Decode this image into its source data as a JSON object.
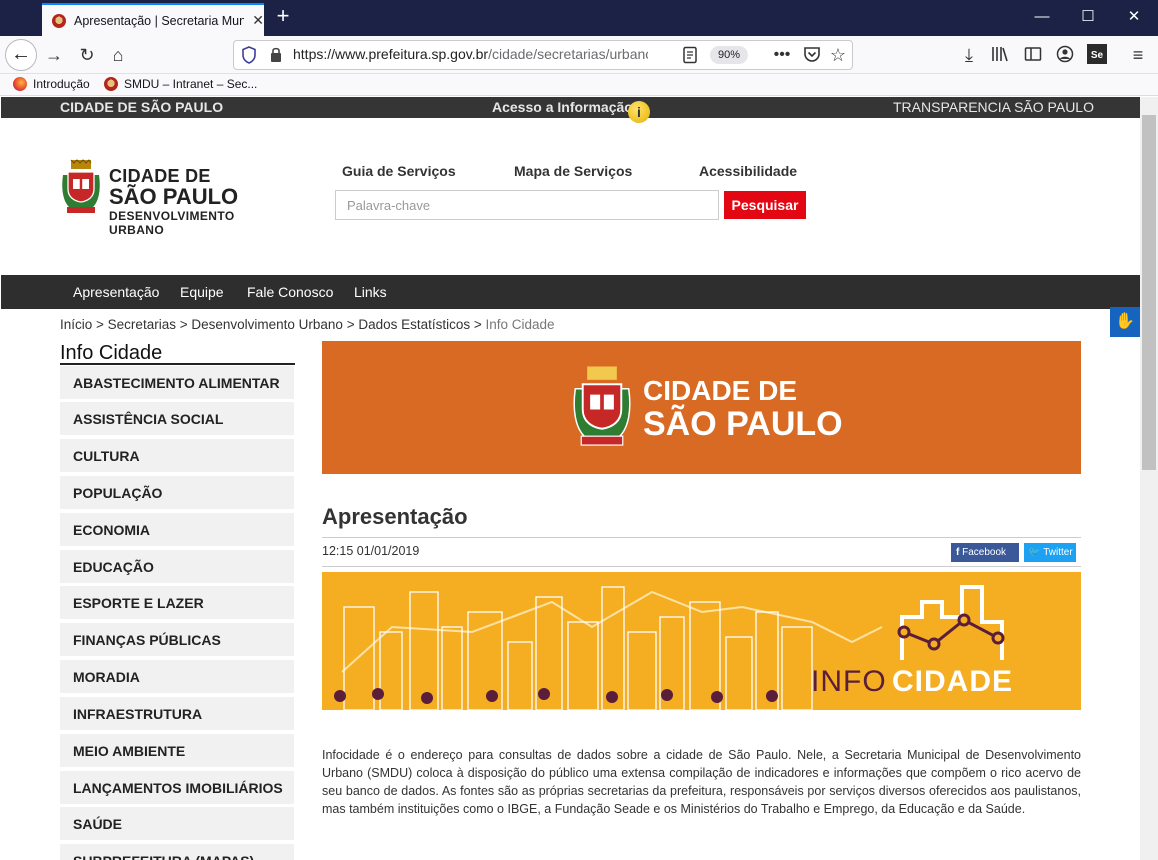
{
  "browser": {
    "tab_title": "Apresentação | Secretaria Muni",
    "url_host": "https://www.prefeitura.sp.gov.br",
    "url_path": "/cidade/secretarias/urbano",
    "zoom": "90%",
    "bookmarks": [
      "Introdução",
      "SMDU – Intranet – Sec..."
    ],
    "icons": [
      "shield-icon",
      "lock-icon",
      "reader-icon",
      "more-icon",
      "pocket-icon",
      "star-icon",
      "download-icon",
      "library-icon",
      "sidebar-icon",
      "account-icon",
      "selenium-icon",
      "menu-icon"
    ]
  },
  "top_strip": {
    "left": "CIDADE DE SÃO PAULO",
    "center": "Acesso a Informação",
    "right": "TRANSPARENCIA SÃO PAULO"
  },
  "logo": {
    "line1": "CIDADE DE",
    "line2": "SÃO PAULO",
    "line3": "DESENVOLVIMENTO",
    "line4": "URBANO"
  },
  "header_links": [
    "Guia de Serviços",
    "Mapa de Serviços",
    "Acessibilidade"
  ],
  "search": {
    "placeholder": "Palavra-chave",
    "button": "Pesquisar"
  },
  "main_nav": [
    "Apresentação",
    "Equipe",
    "Fale Conosco",
    "Links"
  ],
  "breadcrumb": {
    "items": [
      "Início",
      "Secretarias",
      "Desenvolvimento Urbano",
      "Dados Estatísticos"
    ],
    "current": "Info Cidade"
  },
  "sidebar": {
    "title": "Info Cidade",
    "items": [
      "ABASTECIMENTO ALIMENTAR",
      "ASSISTÊNCIA SOCIAL",
      "CULTURA",
      "POPULAÇÃO",
      "ECONOMIA",
      "EDUCAÇÃO",
      "ESPORTE E LAZER",
      "FINANÇAS PÚBLICAS",
      "MORADIA",
      "INFRAESTRUTURA",
      "MEIO AMBIENTE",
      "LANÇAMENTOS IMOBILIÁRIOS",
      "SAÚDE",
      "SUBPREFEITURA (MAPAS)"
    ]
  },
  "banner": {
    "line1": "CIDADE DE",
    "line2": "SÃO PAULO"
  },
  "article": {
    "title": "Apresentação",
    "datetime": "12:15 01/01/2019",
    "facebook": "Facebook",
    "twitter": "Twitter",
    "infobanner_a": "INFO",
    "infobanner_b": "CIDADE",
    "body": "Infocidade é o endereço para consultas de dados sobre a cidade de São Paulo. Nele, a Secretaria Municipal de Desenvolvimento Urbano (SMDU) coloca à disposição do público uma extensa compilação de indicadores e informações que compõem o rico acervo de seu banco de dados. As fontes são as próprias secretarias da prefeitura, responsáveis por serviços diversos oferecidos aos paulistanos, mas também instituições como o IBGE, a Fundação Seade e os Ministérios do Trabalho e Emprego, da Educação e da Saúde."
  },
  "colors": {
    "red": "#e30613",
    "orange_banner": "#d96a23",
    "yellow_banner": "#f5ae22",
    "dark_nav": "#2e2e2e"
  }
}
